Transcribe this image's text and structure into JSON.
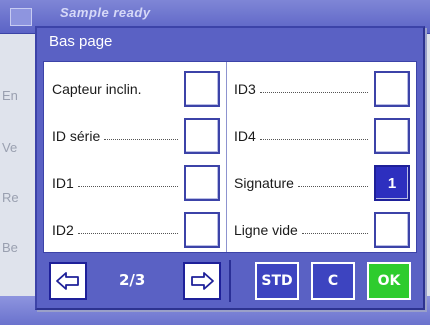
{
  "background": {
    "window_title": "Sample ready",
    "side_labels": [
      "En",
      "Ve",
      "Re",
      "Be"
    ]
  },
  "dialog": {
    "title": "Bas page"
  },
  "left_rows": [
    {
      "label": "Capteur inclin.",
      "value": "",
      "active": false
    },
    {
      "label": "ID série",
      "value": "",
      "active": false
    },
    {
      "label": "ID1",
      "value": "",
      "active": false
    },
    {
      "label": "ID2",
      "value": "",
      "active": false
    }
  ],
  "right_rows": [
    {
      "label": "ID3",
      "value": "",
      "active": false
    },
    {
      "label": "ID4",
      "value": "",
      "active": false
    },
    {
      "label": "Signature",
      "value": "1",
      "active": true
    },
    {
      "label": "Ligne vide",
      "value": "",
      "active": false
    }
  ],
  "buttons": {
    "prev_icon": "arrow-left-icon",
    "next_icon": "arrow-right-icon",
    "page_indicator": "2/3",
    "std": "STD",
    "c": "C",
    "ok": "OK"
  },
  "colors": {
    "dialog_bg": "#5a61c4",
    "active_box": "#2d2fbf",
    "ok_button": "#2ecc2e"
  }
}
